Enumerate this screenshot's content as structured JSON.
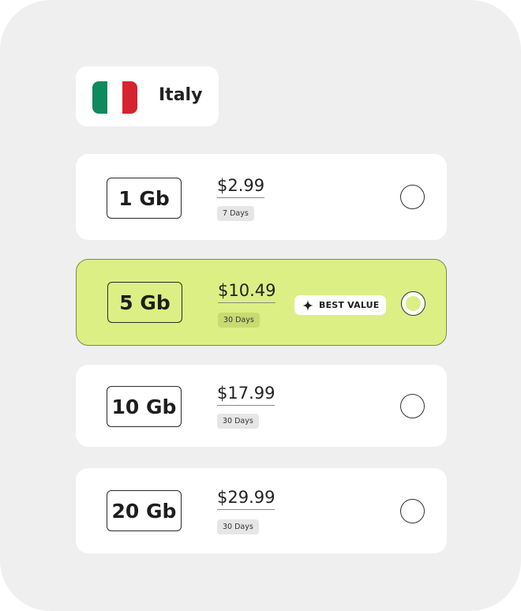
{
  "country": {
    "name": "Italy",
    "flag_colors": [
      "#0f8a5f",
      "#ffffff",
      "#d5232f"
    ]
  },
  "plans": [
    {
      "size": "1 Gb",
      "price": "$2.99",
      "duration": "7 Days",
      "selected": false
    },
    {
      "size": "5 Gb",
      "price": "$10.49",
      "duration": "30 Days",
      "selected": true,
      "badge": "BEST VALUE"
    },
    {
      "size": "10 Gb",
      "price": "$17.99",
      "duration": "30 Days",
      "selected": false
    },
    {
      "size": "20 Gb",
      "price": "$29.99",
      "duration": "30 Days",
      "selected": false
    }
  ],
  "colors": {
    "selected_accent": "#dcef84",
    "background": "#efefef"
  }
}
